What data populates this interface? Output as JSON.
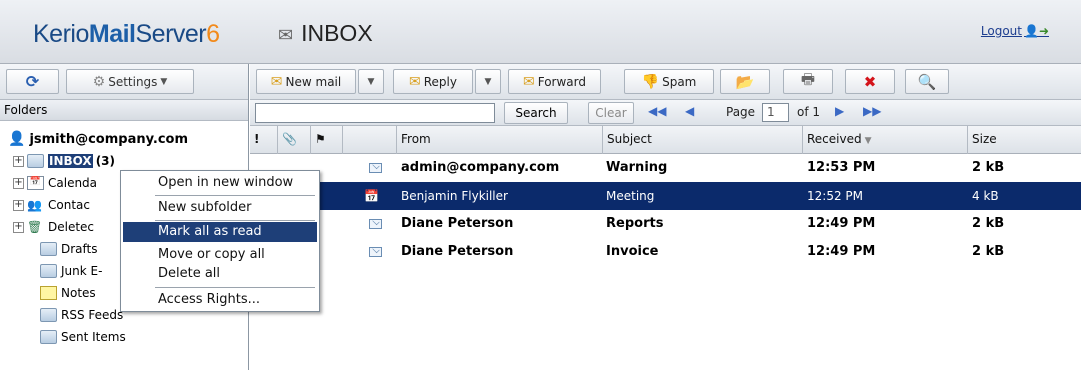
{
  "header": {
    "logo": {
      "part1": "Kerio",
      "part2": "Mail",
      "part3": "Server",
      "part4": "6"
    },
    "folder_title": "INBOX",
    "logout_label": "Logout"
  },
  "left_toolbar": {
    "settings_label": "Settings"
  },
  "folders": {
    "header": "Folders",
    "account": "jsmith@company.com",
    "items": [
      {
        "label": "INBOX",
        "count": "(3)"
      },
      {
        "label": "Calenda"
      },
      {
        "label": "Contac"
      },
      {
        "label": "Deletec"
      },
      {
        "label": "Drafts"
      },
      {
        "label": "Junk E-"
      },
      {
        "label": "Notes"
      },
      {
        "label": "RSS Feeds"
      },
      {
        "label": "Sent Items"
      }
    ]
  },
  "context_menu": {
    "items": [
      {
        "label": "Open in new window"
      },
      {
        "label": "New subfolder"
      },
      {
        "label": "Mark all as read"
      },
      {
        "label": "Move or copy all"
      },
      {
        "label": "Delete all"
      },
      {
        "label": "Access Rights..."
      }
    ]
  },
  "toolbar": {
    "new_mail": "New mail",
    "reply": "Reply",
    "forward": "Forward",
    "spam": "Spam"
  },
  "search": {
    "value": "",
    "search_btn": "Search",
    "clear_btn": "Clear",
    "page_label": "Page",
    "page_value": "1",
    "of_label": "of 1"
  },
  "columns": {
    "from": "From",
    "subject": "Subject",
    "received": "Received",
    "size": "Size"
  },
  "messages": [
    {
      "from": "admin@company.com",
      "subject": "Warning",
      "received": "12:53 PM",
      "size": "2 kB",
      "unread": true
    },
    {
      "from": "Benjamin Flykiller",
      "subject": "Meeting",
      "received": "12:52 PM",
      "size": "4 kB",
      "unread": false,
      "selected": true
    },
    {
      "from": "Diane Peterson",
      "subject": "Reports",
      "received": "12:49 PM",
      "size": "2 kB",
      "unread": true
    },
    {
      "from": "Diane Peterson",
      "subject": "Invoice",
      "received": "12:49 PM",
      "size": "2 kB",
      "unread": true
    }
  ],
  "colors": {
    "selection": "#0b2a6b",
    "menu_selection": "#1e3f78",
    "brand": "#1d5fa8",
    "accent": "#f28a1b"
  }
}
